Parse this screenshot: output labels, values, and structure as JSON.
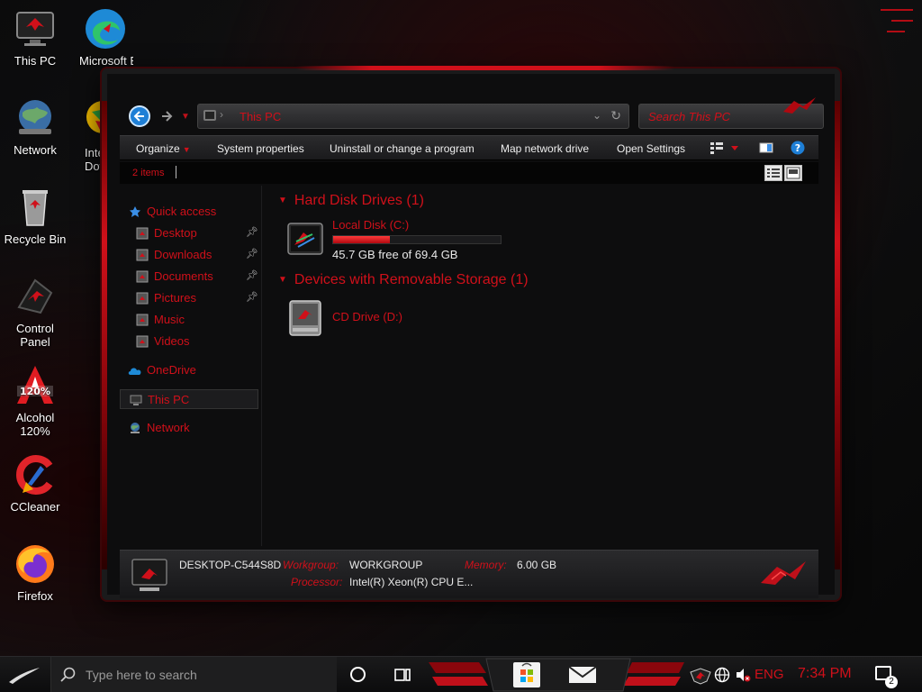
{
  "desktop": {
    "icons": [
      {
        "label": "This PC"
      },
      {
        "label": "Microsoft Ed"
      },
      {
        "label": "Network"
      },
      {
        "label": "Inte Dow"
      },
      {
        "label": "Recycle Bin"
      },
      {
        "label": "Control Panel"
      },
      {
        "label": "Alcohol 120%"
      },
      {
        "label": "CCleaner"
      },
      {
        "label": "Firefox"
      }
    ]
  },
  "explorer": {
    "address": {
      "path": "This PC"
    },
    "search": {
      "placeholder": "Search This PC"
    },
    "commands": {
      "organize": "Organize",
      "system_properties": "System properties",
      "uninstall": "Uninstall or change a program",
      "map_drive": "Map network drive",
      "open_settings": "Open Settings"
    },
    "status": {
      "item_count": "2 items"
    },
    "nav": {
      "quick_access": "Quick access",
      "desktop": "Desktop",
      "downloads": "Downloads",
      "documents": "Documents",
      "pictures": "Pictures",
      "music": "Music",
      "videos": "Videos",
      "onedrive": "OneDrive",
      "this_pc": "This PC",
      "network": "Network"
    },
    "groups": {
      "hdd": {
        "title": "Hard Disk Drives (1)",
        "drive_name": "Local Disk (C:)",
        "used_fraction": 0.34,
        "free_text": "45.7 GB free of 69.4 GB"
      },
      "removable": {
        "title": "Devices with Removable Storage (1)",
        "drive_name": "CD Drive (D:)"
      }
    },
    "details": {
      "computer_name": "DESKTOP-C544S8D",
      "workgroup_label": "Workgroup:",
      "workgroup_value": "WORKGROUP",
      "memory_label": "Memory:",
      "memory_value": "6.00 GB",
      "processor_label": "Processor:",
      "processor_value": "Intel(R) Xeon(R) CPU E..."
    }
  },
  "taskbar": {
    "search_placeholder": "Type here to search",
    "language": "ENG",
    "time": "7:34 PM",
    "notification_count": "2"
  },
  "colors": {
    "accent": "#d0101a",
    "background": "#0d0d0e"
  }
}
